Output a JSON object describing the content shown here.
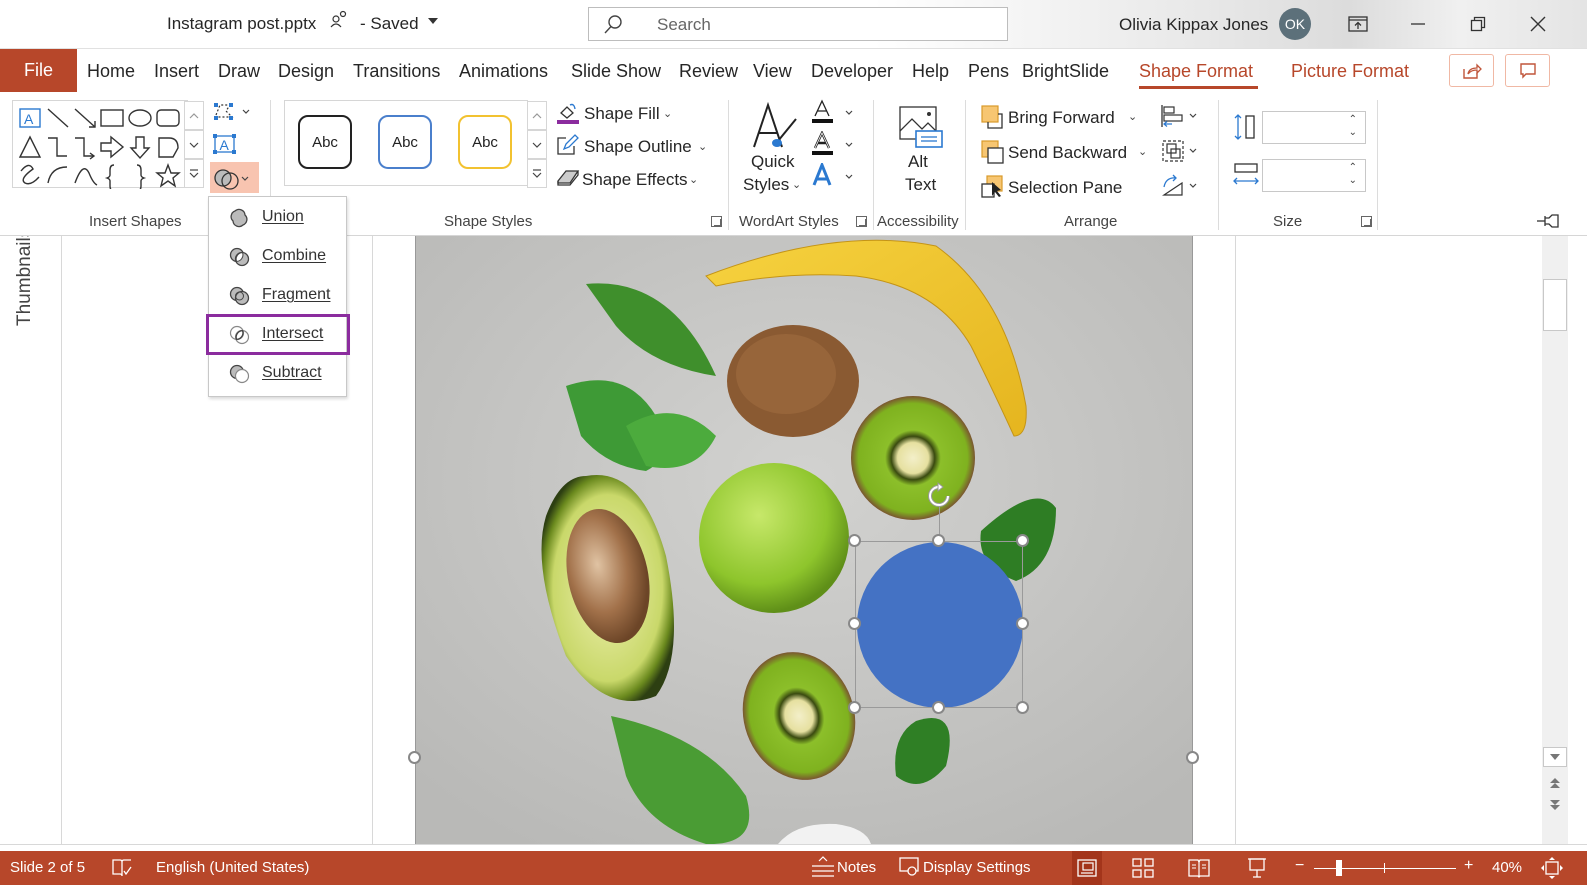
{
  "window": {
    "doc_title": "Instagram post.pptx",
    "save_status": "- Saved",
    "search_placeholder": "Search",
    "user_name": "Olivia Kippax Jones",
    "user_initials": "OK"
  },
  "tabs": {
    "file": "File",
    "items": [
      "Home",
      "Insert",
      "Draw",
      "Design",
      "Transitions",
      "Animations",
      "Slide Show",
      "Review",
      "View",
      "Developer",
      "Help",
      "Pens",
      "BrightSlide",
      "Shape Format",
      "Picture Format"
    ],
    "active": "Shape Format"
  },
  "ribbon": {
    "insert_shapes": {
      "label": "Insert Shapes"
    },
    "shape_styles": {
      "label": "Shape Styles",
      "presets": [
        "Abc",
        "Abc",
        "Abc"
      ],
      "fill": "Shape Fill",
      "outline": "Shape Outline",
      "effects": "Shape Effects"
    },
    "wordart": {
      "label": "WordArt Styles",
      "quick_styles_1": "Quick",
      "quick_styles_2": "Styles"
    },
    "accessibility": {
      "label": "Accessibility",
      "alt_text_1": "Alt",
      "alt_text_2": "Text"
    },
    "arrange": {
      "label": "Arrange",
      "bring_forward": "Bring Forward",
      "send_backward": "Send Backward",
      "selection_pane": "Selection Pane"
    },
    "size": {
      "label": "Size",
      "height_value": "",
      "width_value": ""
    }
  },
  "merge_menu": {
    "items": [
      {
        "label": "Union",
        "accel": "U"
      },
      {
        "label": "Combine",
        "accel": "C"
      },
      {
        "label": "Fragment",
        "accel": "F"
      },
      {
        "label": "Intersect",
        "accel": "I"
      },
      {
        "label": "Subtract",
        "accel": "S"
      }
    ],
    "highlighted": "Intersect"
  },
  "panes": {
    "thumbnails_label": "Thumbnails"
  },
  "status": {
    "slide": "Slide 2 of 5",
    "language": "English (United States)",
    "notes": "Notes",
    "display_settings": "Display Settings",
    "zoom_minus": "−",
    "zoom_plus": "+",
    "zoom_level": "40%",
    "zoom_fraction": 0.4
  },
  "colors": {
    "accent": "#b7472a",
    "highlight_border": "#8b2c9e",
    "merge_button_bg": "#f8c4b0",
    "selected_shape_fill": "#4472c4",
    "shape_fill_underline": "#8b2c9e"
  }
}
